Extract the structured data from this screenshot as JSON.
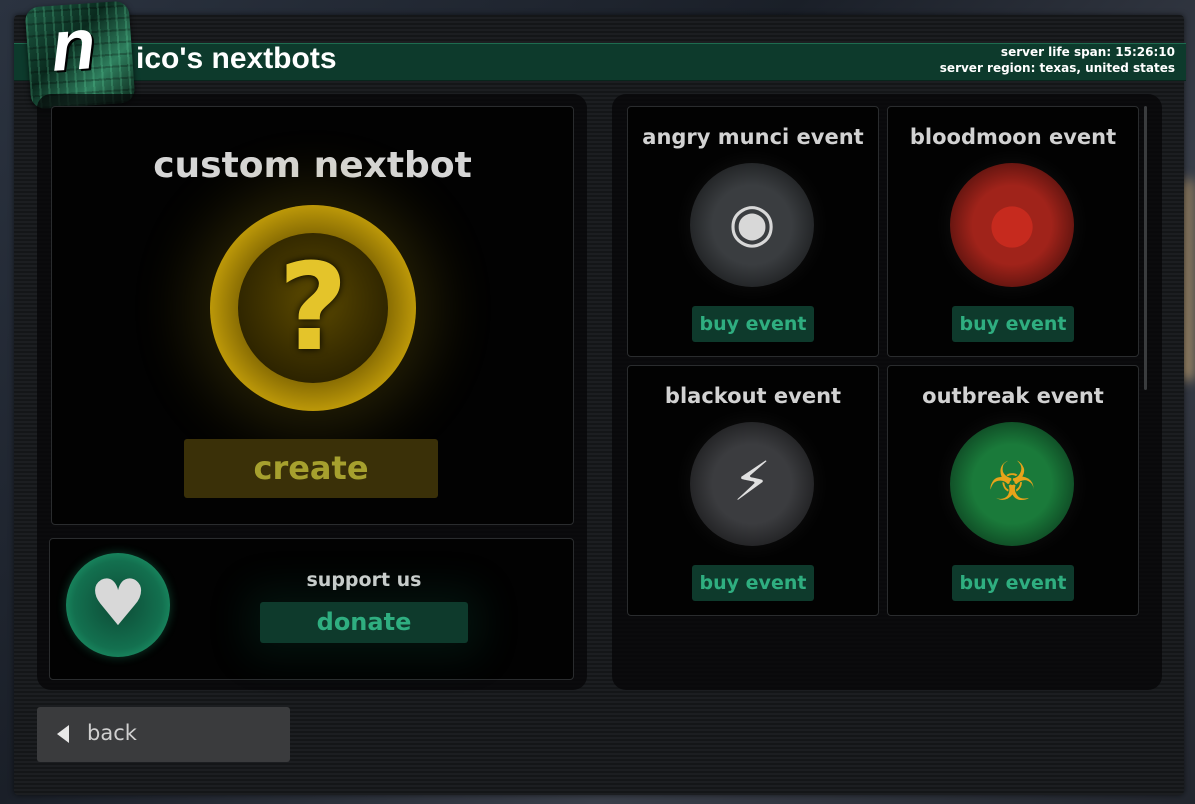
{
  "app": {
    "title": "ico's nextbots",
    "logo_letter": "n"
  },
  "server": {
    "life_span": "server life span: 15:26:10",
    "region": "server region: texas, united states"
  },
  "custom_nextbot": {
    "title": "custom nextbot",
    "icon_glyph": "?",
    "icon": "question-mark-icon",
    "create_label": "create"
  },
  "support": {
    "label": "support us",
    "icon_glyph": "♥",
    "icon": "heart-icon",
    "donate_label": "donate"
  },
  "events": [
    {
      "title": "angry munci event",
      "icon": "eye-icon",
      "glyph": "◉",
      "button": "buy event",
      "colors": [
        "#3a3d40",
        "#0b0c0d"
      ],
      "glyph_color": "#d8d8d8"
    },
    {
      "title": "bloodmoon event",
      "icon": "blood-moon-icon",
      "glyph": "●",
      "button": "buy event",
      "colors": [
        "#a0231a",
        "#2a0706"
      ],
      "glyph_color": "#c62a1e"
    },
    {
      "title": "blackout event",
      "icon": "lightning-icon",
      "glyph": "⚡",
      "button": "buy event",
      "colors": [
        "#3b3c3f",
        "#0b0b0c"
      ],
      "glyph_color": "#e0e0e0"
    },
    {
      "title": "outbreak event",
      "icon": "biohazard-icon",
      "glyph": "☣",
      "button": "buy event",
      "colors": [
        "#1a7a3a",
        "#062213"
      ],
      "glyph_color": "#e8a31a"
    }
  ],
  "back": {
    "label": "back"
  },
  "colors": {
    "accent_green": "#2fae80",
    "button_green_bg": "#0e3a2c",
    "create_bg": "#3a3008",
    "create_text": "#a6a02e"
  }
}
